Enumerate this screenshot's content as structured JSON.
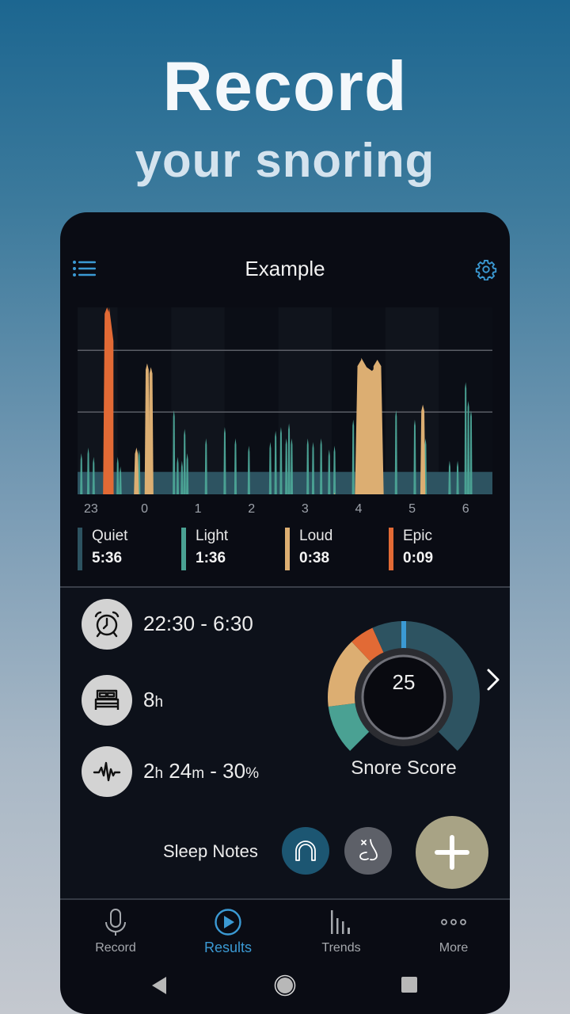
{
  "hero": {
    "title": "Record",
    "subtitle": "your snoring"
  },
  "header": {
    "title": "Example",
    "menu_icon": "list-icon",
    "settings_icon": "gear-icon"
  },
  "colors": {
    "quiet": "#2d5361",
    "light": "#4aa193",
    "loud": "#dcae72",
    "epic": "#e26a35",
    "accent": "#3b9ad4",
    "add_button": "#a8a385",
    "note_active": "#1c5672",
    "note_inactive": "#5d6068"
  },
  "chart_data": {
    "type": "area",
    "title": "",
    "xlabel": "",
    "ylabel": "",
    "x_tick_labels": [
      "23",
      "0",
      "1",
      "2",
      "3",
      "4",
      "5",
      "6"
    ],
    "x_range_hours": [
      22.75,
      6.5
    ],
    "y_range": [
      0,
      100
    ],
    "threshold_lines": [
      44,
      77
    ],
    "quiet_baseline": 12,
    "grid": false,
    "series": [
      {
        "name": "Light",
        "points": [
          [
            22.82,
            22
          ],
          [
            22.95,
            25
          ],
          [
            23.05,
            20
          ],
          [
            23.35,
            32
          ],
          [
            23.4,
            28
          ],
          [
            23.5,
            20
          ],
          [
            23.55,
            15
          ],
          [
            23.9,
            24
          ],
          [
            24.55,
            45
          ],
          [
            24.62,
            20
          ],
          [
            24.7,
            18
          ],
          [
            24.75,
            35
          ],
          [
            24.8,
            22
          ],
          [
            25.15,
            30
          ],
          [
            25.5,
            36
          ],
          [
            25.7,
            30
          ],
          [
            25.95,
            26
          ],
          [
            26.35,
            28
          ],
          [
            26.45,
            34
          ],
          [
            26.55,
            36
          ],
          [
            26.65,
            30
          ],
          [
            26.7,
            38
          ],
          [
            26.75,
            30
          ],
          [
            27.05,
            30
          ],
          [
            27.15,
            28
          ],
          [
            27.3,
            30
          ],
          [
            27.45,
            24
          ],
          [
            27.55,
            26
          ],
          [
            27.9,
            40
          ],
          [
            28.2,
            55
          ],
          [
            28.7,
            45
          ],
          [
            29.05,
            40
          ],
          [
            29.25,
            30
          ],
          [
            29.7,
            18
          ],
          [
            29.85,
            18
          ],
          [
            30.0,
            60
          ],
          [
            30.05,
            50
          ],
          [
            30.1,
            45
          ]
        ]
      },
      {
        "name": "Loud",
        "points": [
          [
            23.85,
            25
          ],
          [
            24.05,
            70
          ],
          [
            24.12,
            68
          ],
          [
            27.55,
            1
          ],
          [
            28.05,
            72
          ],
          [
            28.35,
            72
          ],
          [
            29.2,
            48
          ]
        ]
      },
      {
        "name": "Epic",
        "points": [
          [
            23.3,
            100
          ],
          [
            23.35,
            90
          ]
        ]
      }
    ]
  },
  "legend": [
    {
      "label": "Quiet",
      "value": "5:36",
      "color_key": "quiet"
    },
    {
      "label": "Light",
      "value": "1:36",
      "color_key": "light"
    },
    {
      "label": "Loud",
      "value": "0:38",
      "color_key": "loud"
    },
    {
      "label": "Epic",
      "value": "0:09",
      "color_key": "epic"
    }
  ],
  "info": {
    "time_range": "22:30 - 6:30",
    "time_icon": "alarm-clock-icon",
    "duration_value": "8",
    "duration_unit": "h",
    "duration_icon": "bed-icon",
    "snore_hours": "2",
    "snore_hours_unit": "h",
    "snore_minutes": "24",
    "snore_minutes_unit": "m",
    "snore_sep": " - ",
    "snore_percent": "30",
    "snore_percent_unit": "%",
    "snore_icon": "waveform-icon"
  },
  "snore_score": {
    "value": "25",
    "label": "Snore Score",
    "segments_fraction": {
      "light": 0.14,
      "loud": 0.2,
      "epic": 0.07,
      "quiet": 0.59
    }
  },
  "sleep_notes": {
    "label": "Sleep Notes",
    "items": [
      {
        "name": "mouthguard",
        "icon": "mouthguard-icon",
        "active": true
      },
      {
        "name": "nasal",
        "icon": "nose-icon",
        "active": false
      }
    ],
    "add_icon": "plus-icon"
  },
  "bottom_nav": [
    {
      "label": "Record",
      "icon": "microphone-icon",
      "active": false
    },
    {
      "label": "Results",
      "icon": "play-circle-icon",
      "active": true
    },
    {
      "label": "Trends",
      "icon": "bar-chart-icon",
      "active": false
    },
    {
      "label": "More",
      "icon": "more-dots-icon",
      "active": false
    }
  ],
  "system_nav": [
    "back-icon",
    "home-icon",
    "recents-icon"
  ]
}
